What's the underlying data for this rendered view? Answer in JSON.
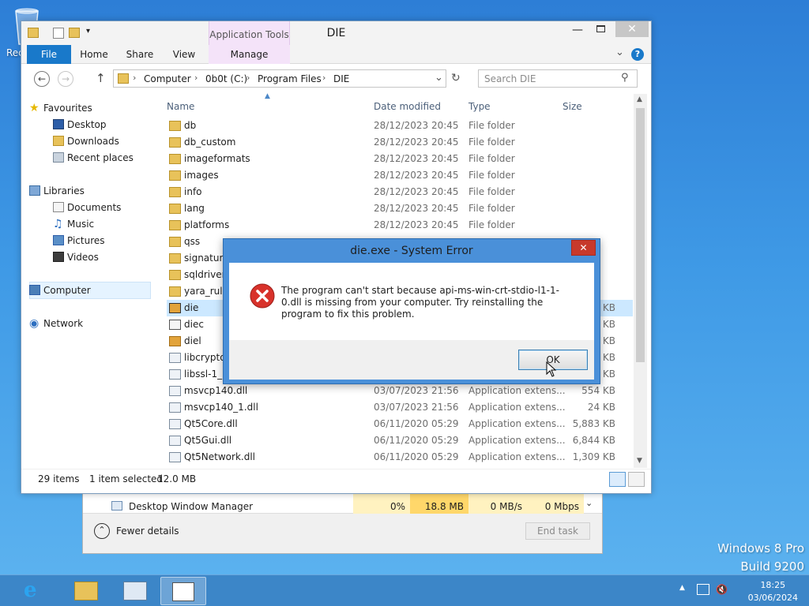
{
  "desktop": {
    "recycle_label": "Rec",
    "edition": "Windows 8 Pro",
    "build": "Build 9200"
  },
  "taskbar": {
    "time": "18:25",
    "date": "03/06/2024"
  },
  "task_manager": {
    "process": "Desktop Window Manager",
    "cpu": "0%",
    "memory": "18.8 MB",
    "disk": "0 MB/s",
    "network": "0 Mbps",
    "fewer_details": "Fewer details",
    "end_task": "End task"
  },
  "explorer": {
    "title": "DIE",
    "app_tools": "Application Tools",
    "tabs": {
      "file": "File",
      "home": "Home",
      "share": "Share",
      "view": "View",
      "manage": "Manage"
    },
    "breadcrumb": [
      "Computer",
      "0b0t (C:)",
      "Program Files",
      "DIE"
    ],
    "search_placeholder": "Search DIE",
    "nav": {
      "favourites": "Favourites",
      "desktop": "Desktop",
      "downloads": "Downloads",
      "recent": "Recent places",
      "libraries": "Libraries",
      "documents": "Documents",
      "music": "Music",
      "pictures": "Pictures",
      "videos": "Videos",
      "computer": "Computer",
      "network": "Network"
    },
    "columns": {
      "name": "Name",
      "date": "Date modified",
      "type": "Type",
      "size": "Size"
    },
    "files": [
      {
        "name": "db",
        "date": "28/12/2023 20:45",
        "type": "File folder",
        "size": ""
      },
      {
        "name": "db_custom",
        "date": "28/12/2023 20:45",
        "type": "File folder",
        "size": ""
      },
      {
        "name": "imageformats",
        "date": "28/12/2023 20:45",
        "type": "File folder",
        "size": ""
      },
      {
        "name": "images",
        "date": "28/12/2023 20:45",
        "type": "File folder",
        "size": ""
      },
      {
        "name": "info",
        "date": "28/12/2023 20:45",
        "type": "File folder",
        "size": ""
      },
      {
        "name": "lang",
        "date": "28/12/2023 20:45",
        "type": "File folder",
        "size": ""
      },
      {
        "name": "platforms",
        "date": "28/12/2023 20:45",
        "type": "File folder",
        "size": ""
      },
      {
        "name": "qss",
        "date": "",
        "type": "",
        "size": ""
      },
      {
        "name": "signature",
        "date": "",
        "type": "",
        "size": ""
      },
      {
        "name": "sqldrivers",
        "date": "",
        "type": "",
        "size": ""
      },
      {
        "name": "yara_rules",
        "date": "",
        "type": "",
        "size": ""
      },
      {
        "name": "die",
        "date": "",
        "type": "",
        "size": "KB"
      },
      {
        "name": "diec",
        "date": "",
        "type": "",
        "size": "KB"
      },
      {
        "name": "diel",
        "date": "",
        "type": "",
        "size": "KB"
      },
      {
        "name": "libcrypto-",
        "date": "",
        "type": "",
        "size": "KB"
      },
      {
        "name": "libssl-1_1-",
        "date": "",
        "type": "",
        "size": "KB"
      },
      {
        "name": "msvcp140.dll",
        "date": "03/07/2023 21:56",
        "type": "Application extens...",
        "size": "554 KB"
      },
      {
        "name": "msvcp140_1.dll",
        "date": "03/07/2023 21:56",
        "type": "Application extens...",
        "size": "24 KB"
      },
      {
        "name": "Qt5Core.dll",
        "date": "06/11/2020 05:29",
        "type": "Application extens...",
        "size": "5,883 KB"
      },
      {
        "name": "Qt5Gui.dll",
        "date": "06/11/2020 05:29",
        "type": "Application extens...",
        "size": "6,844 KB"
      },
      {
        "name": "Qt5Network.dll",
        "date": "06/11/2020 05:29",
        "type": "Application extens...",
        "size": "1,309 KB"
      }
    ],
    "status": {
      "count": "29 items",
      "selected": "1 item selected",
      "size": "12.0 MB"
    }
  },
  "dialog": {
    "title": "die.exe - System Error",
    "message": "The program can't start because api-ms-win-crt-stdio-l1-1-0.dll is missing from your computer. Try reinstalling the program to fix this problem.",
    "ok": "OK"
  }
}
